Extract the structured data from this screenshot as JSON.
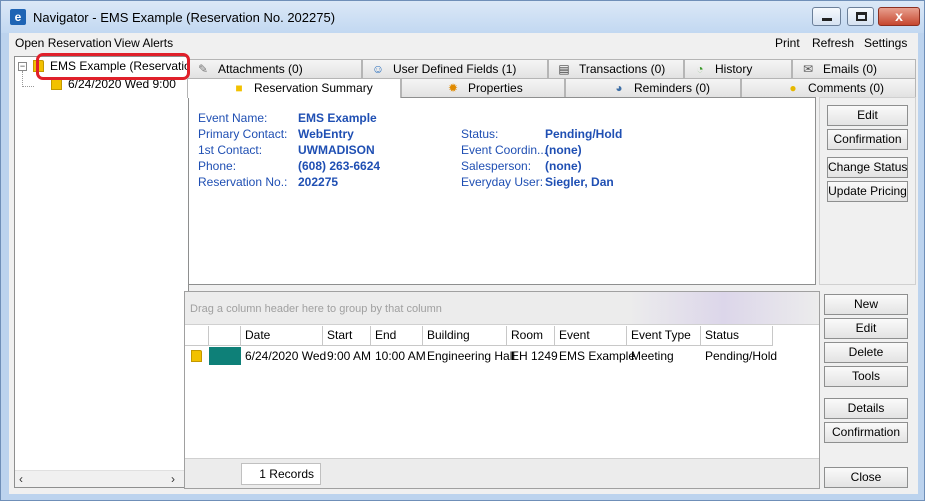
{
  "window": {
    "title": "Navigator - EMS Example (Reservation No. 202275)",
    "minimize_glyph": "",
    "close_glyph": "x"
  },
  "menu": {
    "left": [
      "Open Reservation",
      "View Alerts"
    ],
    "right": [
      "Print",
      "Refresh",
      "Settings"
    ]
  },
  "tree": {
    "root_label": "EMS Example (Reservatio",
    "child_label": "6/24/2020 Wed 9:00",
    "expander": "−"
  },
  "tabs": {
    "row1": [
      {
        "label": "Attachments (0)",
        "icon": "paperclip-icon"
      },
      {
        "label": "User Defined Fields (1)",
        "icon": "user-fields-icon"
      },
      {
        "label": "Transactions (0)",
        "icon": "transactions-icon"
      },
      {
        "label": "History",
        "icon": "history-icon"
      },
      {
        "label": "Emails (0)",
        "icon": "email-icon"
      }
    ],
    "row2": [
      {
        "label": "Reservation Summary",
        "icon": "folder-icon"
      },
      {
        "label": "Properties",
        "icon": "properties-icon"
      },
      {
        "label": "Reminders (0)",
        "icon": "reminders-icon"
      },
      {
        "label": "Comments (0)",
        "icon": "comments-icon"
      }
    ]
  },
  "summary": {
    "event_name_label": "Event Name:",
    "event_name": "EMS Example",
    "primary_contact_label": "Primary Contact:",
    "primary_contact": "WebEntry",
    "first_contact_label": "1st Contact:",
    "first_contact": "UWMADISON",
    "phone_label": "Phone:",
    "phone": "(608) 263-6624",
    "reservation_no_label": "Reservation No.:",
    "reservation_no": "202275",
    "status_label": "Status:",
    "status": "Pending/Hold",
    "event_coordinator_label": "Event Coordin...",
    "event_coordinator": "(none)",
    "salesperson_label": "Salesperson:",
    "salesperson": "(none)",
    "everyday_user_label": "Everyday User:",
    "everyday_user": "Siegler, Dan"
  },
  "summary_buttons": [
    "Edit",
    "Confirmation",
    "Change Status",
    "Update Pricing"
  ],
  "grid": {
    "group_hint": "Drag a column header here to group by that column",
    "columns": [
      "Date",
      "Start",
      "End",
      "Building",
      "Room",
      "Event",
      "Event Type",
      "Status"
    ],
    "rows": [
      {
        "Date": "6/24/2020 Wed",
        "Start": "9:00 AM",
        "End": "10:00 AM",
        "Building": "Engineering Hall",
        "Room": "EH 1249",
        "Event": "EMS Example",
        "Event Type": "Meeting",
        "Status": "Pending/Hold",
        "status_color": "#0e8078"
      }
    ],
    "records": "1 Records"
  },
  "booking_buttons": [
    "New",
    "Edit",
    "Delete",
    "Tools",
    "Details",
    "Confirmation",
    "Close"
  ],
  "colors": {
    "label_blue": "#1f4fb3",
    "highlight_red": "#e0202a",
    "booking_teal": "#0e8078"
  }
}
